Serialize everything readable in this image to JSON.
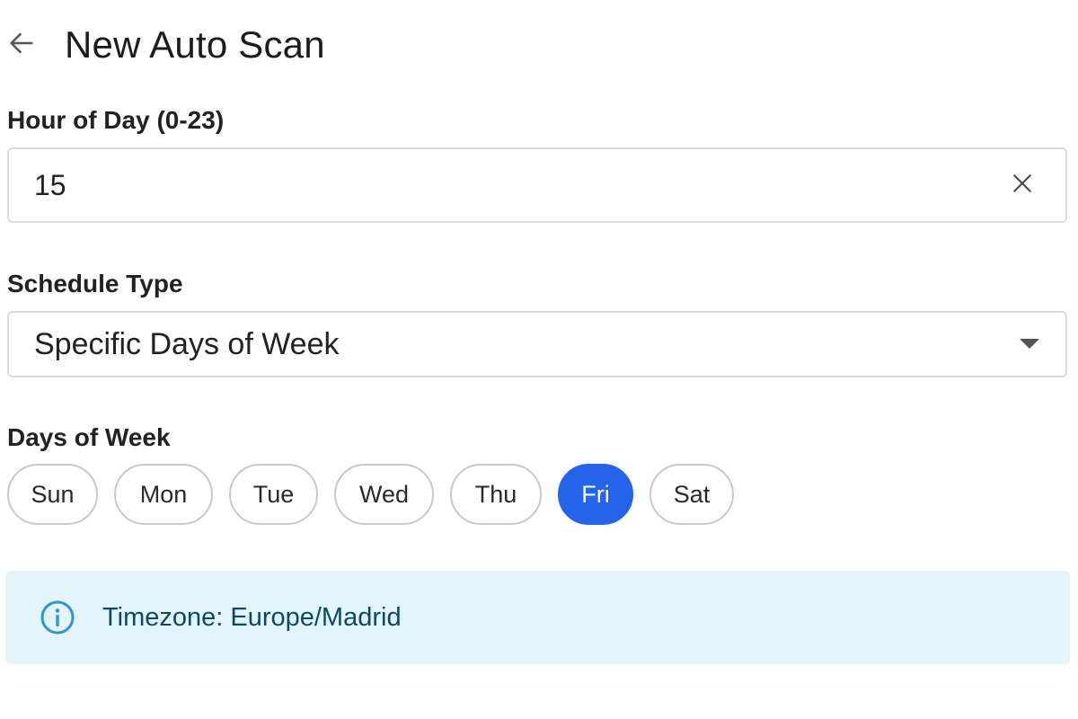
{
  "header": {
    "back_icon": "arrow-left-icon",
    "title": "New Auto Scan"
  },
  "hour_field": {
    "label": "Hour of Day (0-23)",
    "value": "15",
    "clear_icon": "close-icon"
  },
  "schedule_type": {
    "label": "Schedule Type",
    "selected": "Specific Days of Week",
    "arrow_icon": "caret-down-icon"
  },
  "days_of_week": {
    "label": "Days of Week",
    "days": [
      {
        "label": "Sun",
        "selected": false
      },
      {
        "label": "Mon",
        "selected": false
      },
      {
        "label": "Tue",
        "selected": false
      },
      {
        "label": "Wed",
        "selected": false
      },
      {
        "label": "Thu",
        "selected": false
      },
      {
        "label": "Fri",
        "selected": true
      },
      {
        "label": "Sat",
        "selected": false
      }
    ]
  },
  "info": {
    "icon": "info-icon",
    "text": "Timezone: Europe/Madrid"
  },
  "colors": {
    "accent": "#2563eb",
    "info_background": "#e3f4fb",
    "info_text": "#0b4a66",
    "info_icon": "#2f95d0",
    "border": "#dcdcdc"
  }
}
